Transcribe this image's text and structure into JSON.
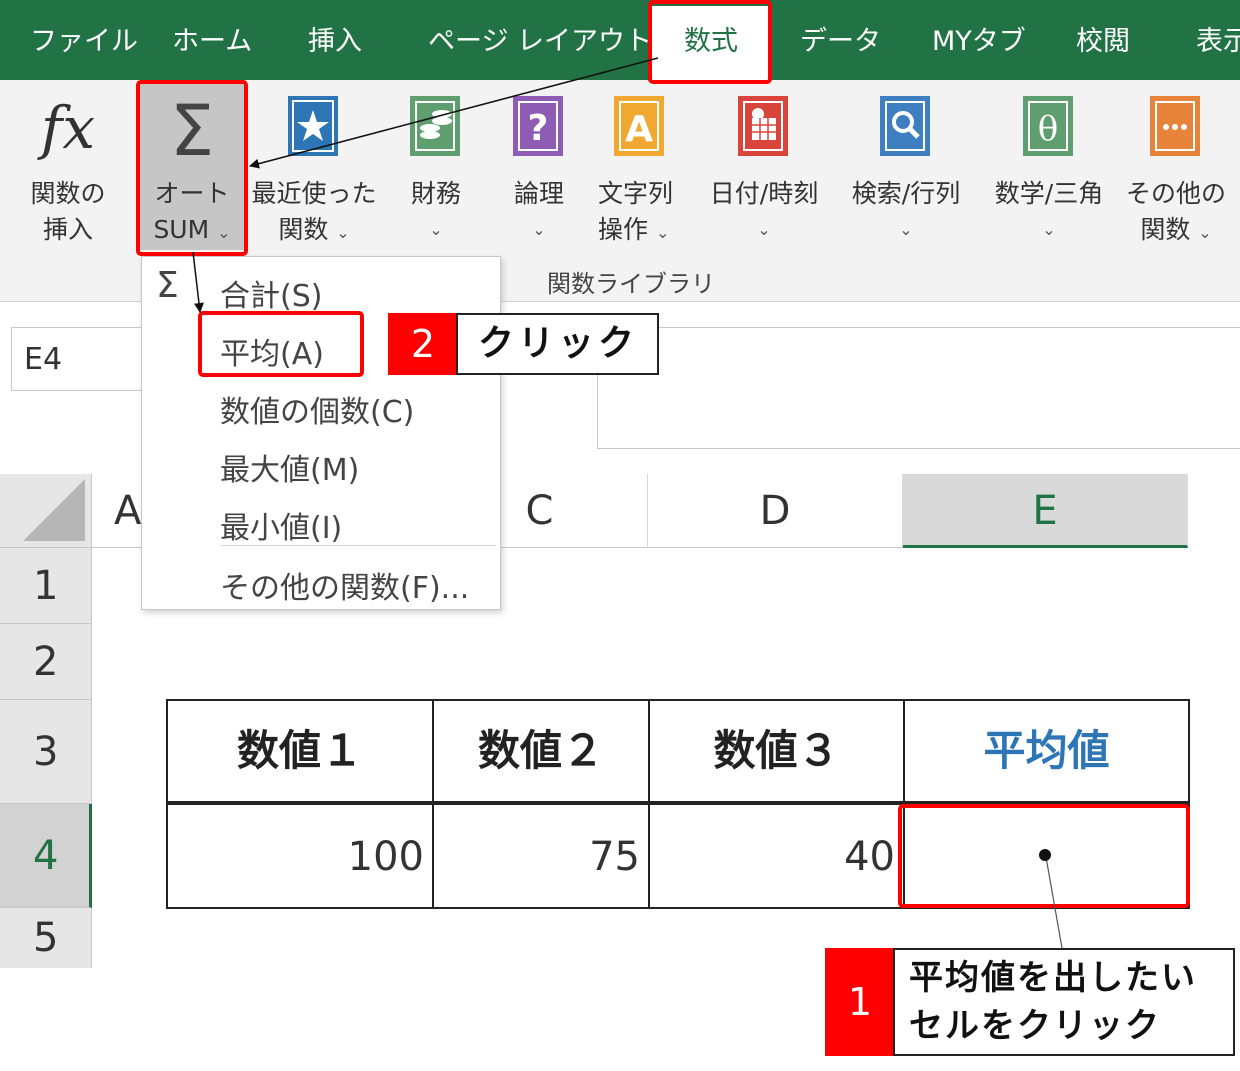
{
  "tabs": [
    {
      "label": "ファイル"
    },
    {
      "label": "ホーム"
    },
    {
      "label": "挿入"
    },
    {
      "label": "ページ レイアウト"
    },
    {
      "label": "数式"
    },
    {
      "label": "データ"
    },
    {
      "label": "MYタブ"
    },
    {
      "label": "校閲"
    },
    {
      "label": "表示"
    }
  ],
  "ribbon": {
    "insert_function": {
      "line1": "関数の",
      "line2": "挿入"
    },
    "autosum": {
      "line1": "オート",
      "line2": "SUM"
    },
    "recent": {
      "line1": "最近使った",
      "line2": "関数"
    },
    "financial": {
      "line1": "財務"
    },
    "logical": {
      "line1": "論理"
    },
    "text": {
      "line1": "文字列",
      "line2": "操作"
    },
    "datetime": {
      "line1": "日付/時刻"
    },
    "lookup": {
      "line1": "検索/行列"
    },
    "math": {
      "line1": "数学/三角"
    },
    "more": {
      "line1": "その他の",
      "line2": "関数"
    },
    "group_label": "関数ライブラリ",
    "dropdown_glyph": "⌄"
  },
  "name_box": "E4",
  "menu": {
    "sum": "合計(S)",
    "average": "平均(A)",
    "count": "数値の個数(C)",
    "max": "最大値(M)",
    "min": "最小値(I)",
    "more_functions": "その他の関数(F)..."
  },
  "grid": {
    "columns": [
      "A",
      "C",
      "D",
      "E"
    ],
    "rows": [
      "1",
      "2",
      "3",
      "4",
      "5"
    ],
    "selected_cell": "E4"
  },
  "table": {
    "headers": [
      "数値１",
      "数値２",
      "数値３",
      "平均値"
    ],
    "values": [
      "100",
      "75",
      "40",
      ""
    ]
  },
  "callouts": {
    "step1": {
      "number": "1",
      "line1": "平均値を出したい",
      "line2": "セルをクリック"
    },
    "step2": {
      "number": "2",
      "text": "クリック"
    }
  },
  "colors": {
    "excel_green": "#217346",
    "highlight_red": "#ff0000",
    "header_blue": "#2e75b6"
  }
}
